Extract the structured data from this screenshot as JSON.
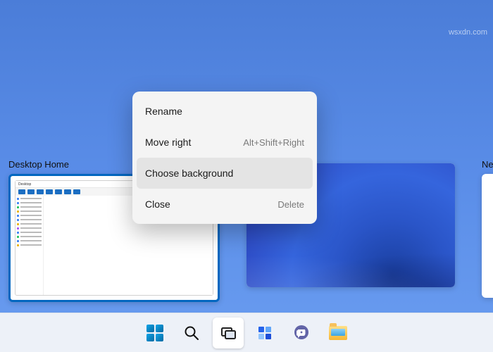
{
  "watermark": "wsxdn.com",
  "desktops": [
    {
      "label": "Desktop Home"
    },
    {
      "label": ""
    },
    {
      "label": "New"
    }
  ],
  "context_menu": {
    "rename": {
      "label": "Rename",
      "hint": ""
    },
    "move_right": {
      "label": "Move right",
      "hint": "Alt+Shift+Right"
    },
    "choose_bg": {
      "label": "Choose background",
      "hint": ""
    },
    "close": {
      "label": "Close",
      "hint": "Delete"
    }
  },
  "taskbar": {
    "start": "start-icon",
    "search": "search-icon",
    "task_view": "task-view-icon",
    "widgets": "widgets-icon",
    "chat": "chat-icon",
    "explorer": "file-explorer-icon"
  },
  "colors": {
    "accent": "#0067c0",
    "menu_bg": "#f4f4f4",
    "menu_hover": "#e4e4e4",
    "taskbar_bg": "#edf1f8"
  }
}
